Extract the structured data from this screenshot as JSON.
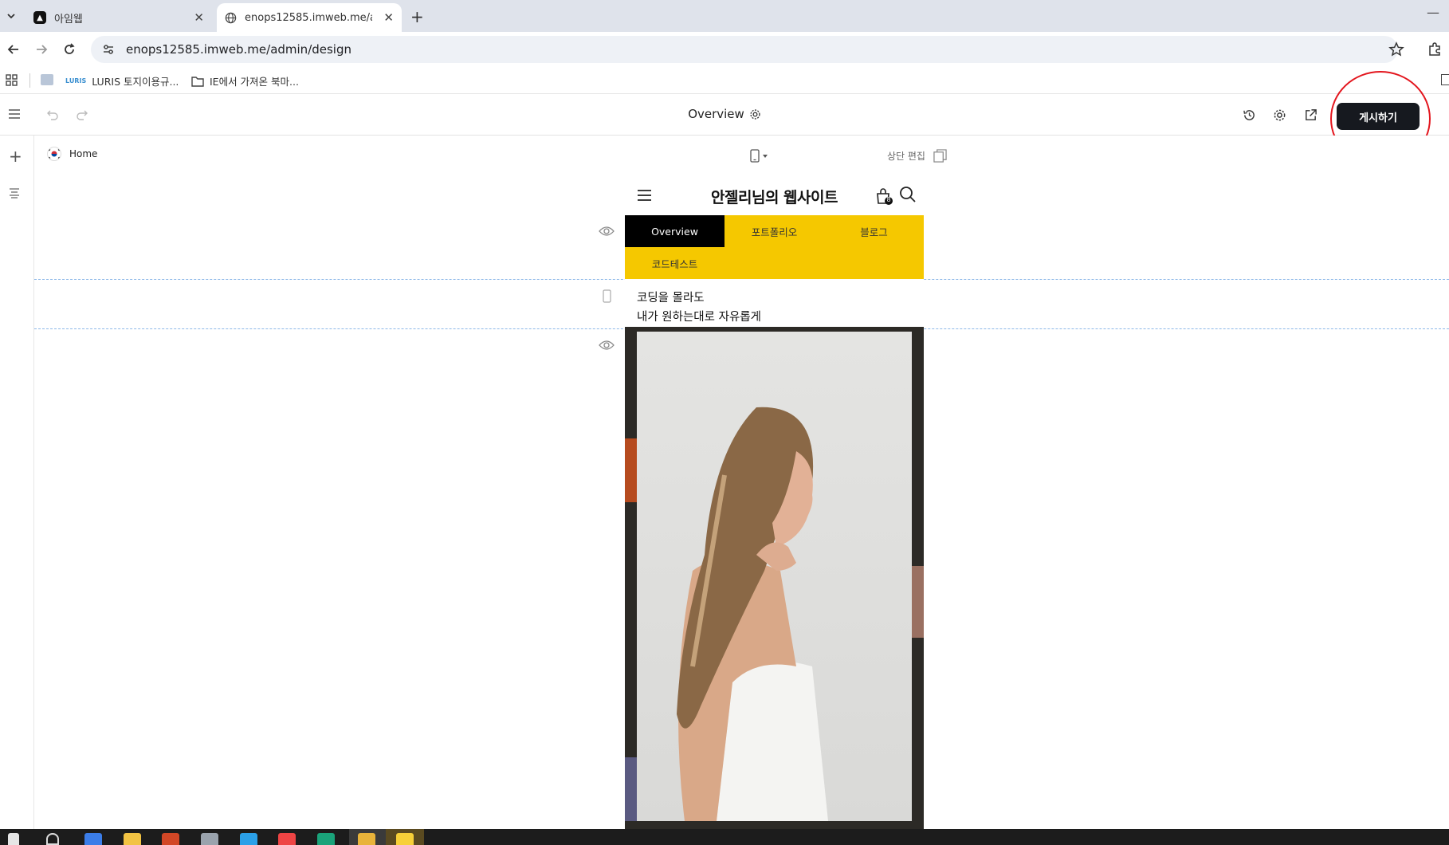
{
  "browser": {
    "tabs": [
      {
        "title": "아임웹",
        "active": false
      },
      {
        "title": "enops12585.imweb.me/admin/design",
        "active": true
      }
    ],
    "url": "enops12585.imweb.me/admin/design",
    "bookmarks": [
      {
        "label": "LURIS 토지이용규...",
        "icon_text": "LURIS"
      },
      {
        "label": "IE에서 가져온 북마..."
      }
    ]
  },
  "editor": {
    "page_title": "Overview",
    "publish_label": "게시하기",
    "current_page": "Home",
    "section_edit_label": "상단 편집"
  },
  "site": {
    "title": "안젤리님의 웹사이트",
    "cart_count": "8",
    "nav": [
      "Overview",
      "포트폴리오",
      "블로그",
      "코드테스트"
    ],
    "tagline": [
      "코딩을 몰라도",
      "내가 원하는대로 자유롭게"
    ]
  },
  "colors": {
    "nav_background": "#f5c800",
    "nav_active": "#000000",
    "publish_button": "#16191f",
    "annotation_circle": "#e3161e",
    "guide_line": "#8db8e8"
  },
  "icons": [
    "tab-search-icon",
    "back-icon",
    "forward-icon",
    "reload-icon",
    "site-info-icon",
    "star-icon",
    "extensions-icon",
    "apps-grid-icon",
    "folder-icon",
    "menu-icon",
    "undo-icon",
    "redo-icon",
    "settings-icon",
    "history-icon",
    "external-link-icon",
    "add-icon",
    "layers-icon",
    "korea-flag-icon",
    "mobile-device-icon",
    "copy-icon",
    "hamburger-icon",
    "cart-icon",
    "search-icon",
    "eye-icon"
  ]
}
